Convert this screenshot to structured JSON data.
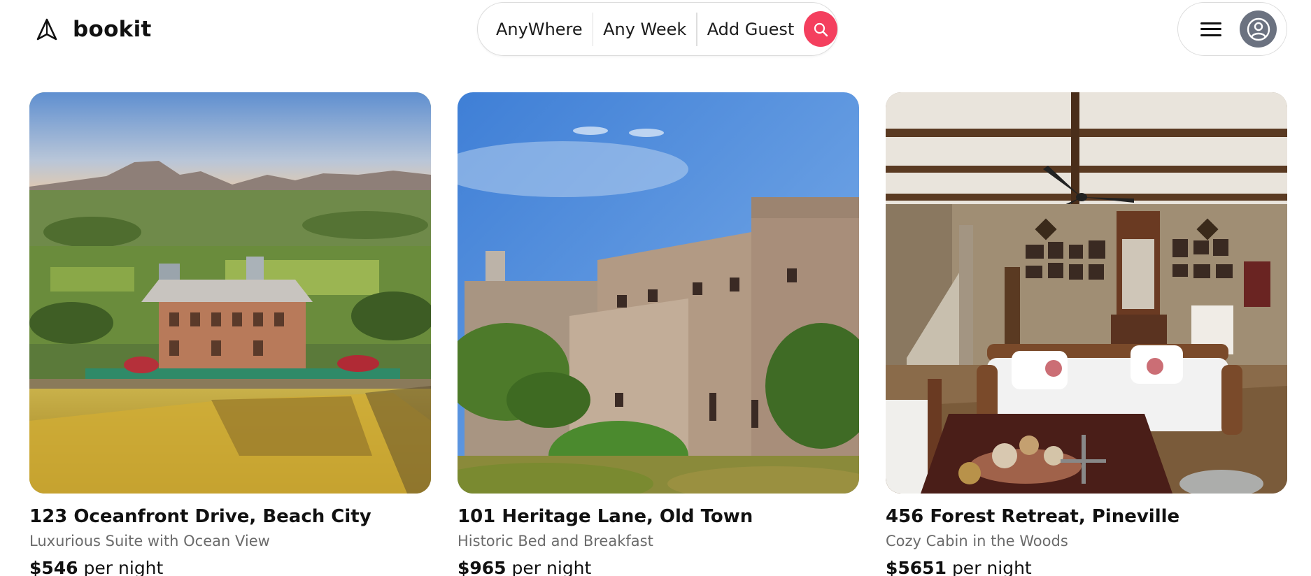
{
  "brand": {
    "name": "bookit",
    "icon": "navigation-arrow-icon"
  },
  "search": {
    "where": "AnyWhere",
    "when": "Any Week",
    "guests": "Add Guest",
    "icon": "search-icon",
    "button_color": "#f43f5e"
  },
  "user_menu": {
    "menu_icon": "hamburger-menu-icon",
    "avatar_icon": "user-circle-icon"
  },
  "listings": [
    {
      "title": "123 Oceanfront Drive, Beach City",
      "subtitle": "Luxurious Suite with Ocean View",
      "price": "$546",
      "unit": "per night"
    },
    {
      "title": "101 Heritage Lane, Old Town",
      "subtitle": "Historic Bed and Breakfast",
      "price": "$965",
      "unit": "per night"
    },
    {
      "title": "456 Forest Retreat, Pineville",
      "subtitle": "Cozy Cabin in the Woods",
      "price": "$5651",
      "unit": "per night"
    }
  ]
}
